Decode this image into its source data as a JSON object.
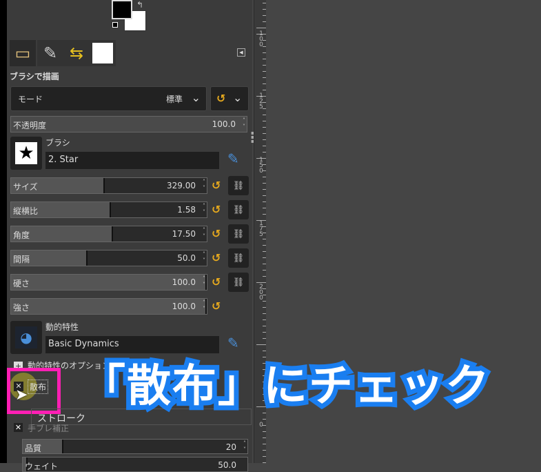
{
  "tool_title": "ブラシで描画",
  "mode": {
    "label": "モード",
    "value": "標準"
  },
  "opacity": {
    "label": "不透明度",
    "value": "100.0"
  },
  "brush": {
    "label": "ブラシ",
    "value": "2. Star"
  },
  "sliders": [
    {
      "label": "サイズ",
      "value": "329.00",
      "fraction": 0.48
    },
    {
      "label": "縦横比",
      "value": "1.58",
      "fraction": 0.51
    },
    {
      "label": "角度",
      "value": "17.50",
      "fraction": 0.52
    },
    {
      "label": "間隔",
      "value": "50.0",
      "fraction": 0.39
    },
    {
      "label": "硬さ",
      "value": "100.0",
      "fraction": 1.0
    },
    {
      "label": "強さ",
      "value": "100.0",
      "fraction": 1.0
    }
  ],
  "dynamics": {
    "label": "動的特性",
    "value": "Basic Dynamics",
    "options_label": "動的特性のオプション"
  },
  "scatter_label": "散布",
  "stroke_label": "ストローク",
  "smoothing_label": "手ブレ補正",
  "quality": {
    "label": "品質",
    "value": "20"
  },
  "weight": {
    "label": "ウェイト",
    "value": "50.0"
  },
  "ruler_labels": [
    "100",
    "125",
    "150",
    "175",
    "200",
    "0"
  ],
  "caption": "「散布」にチェック",
  "colors": {
    "highlight": "#ff1fb4",
    "caption_stroke": "#1a7ef0",
    "reset": "#e6a91e"
  }
}
